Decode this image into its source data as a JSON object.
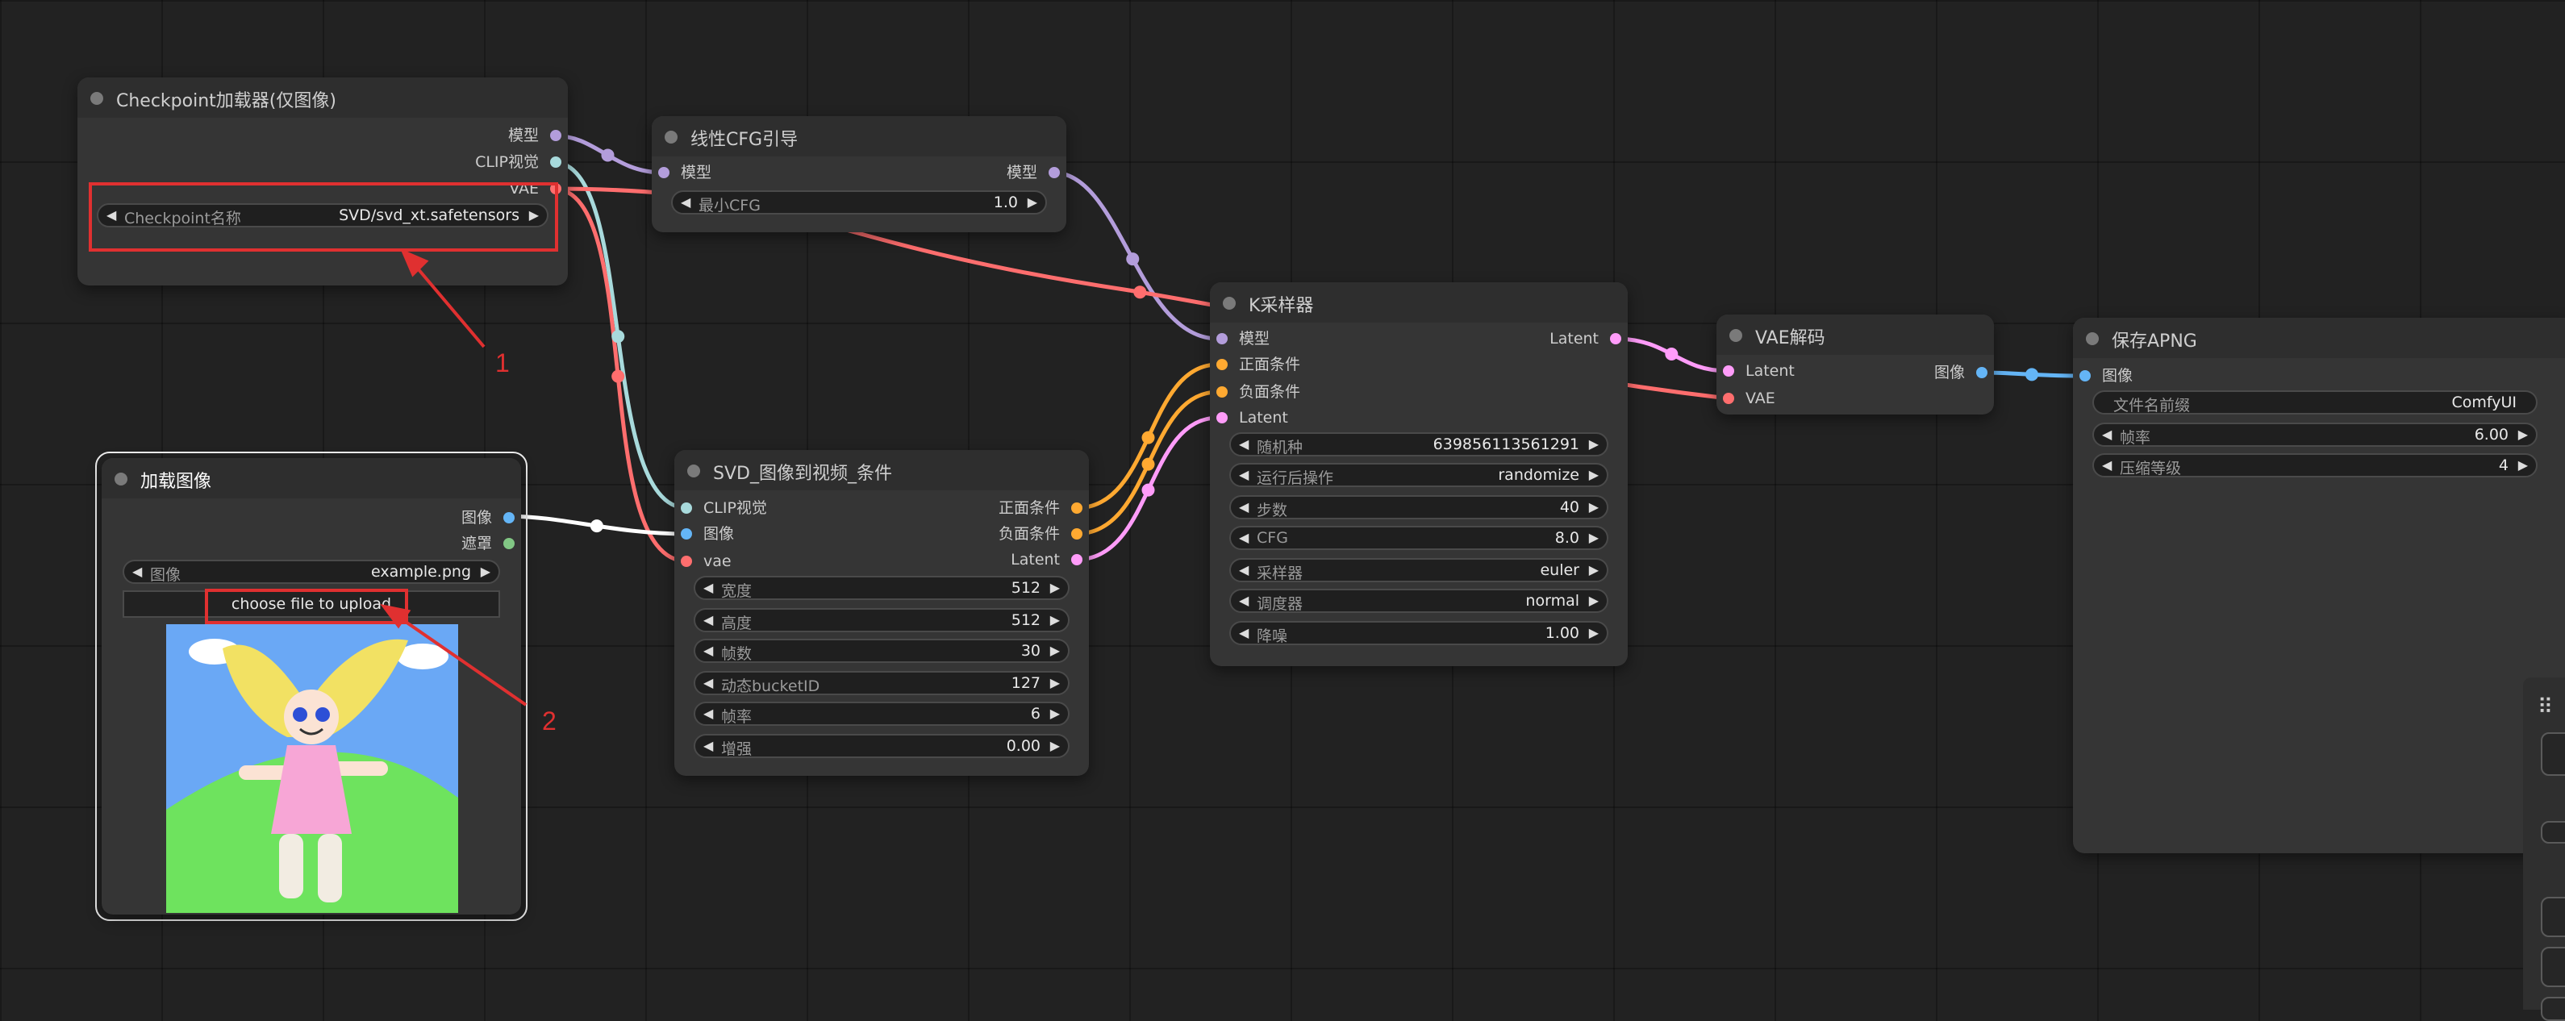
{
  "colors": {
    "model": "#b39ddb",
    "clip_vision": "#a8dadc",
    "vae": "#ff6e6e",
    "image": "#64b5f6",
    "mask": "#81c784",
    "conditioning": "#ffa931",
    "latent": "#ff9cf9",
    "annotation": "#e03030"
  },
  "nodes": {
    "checkpoint_loader": {
      "title": "Checkpoint加载器(仅图像)",
      "outputs": [
        "模型",
        "CLIP视觉",
        "VAE"
      ],
      "widget": {
        "label": "Checkpoint名称",
        "value": "SVD/svd_xt.safetensors"
      }
    },
    "linear_cfg": {
      "title": "线性CFG引导",
      "input": "模型",
      "output": "模型",
      "widget": {
        "label": "最小CFG",
        "value": "1.0"
      }
    },
    "load_image": {
      "title": "加载图像",
      "outputs": [
        "图像",
        "遮罩"
      ],
      "widget": {
        "label": "图像",
        "value": "example.png"
      },
      "upload_label": "choose file to upload"
    },
    "svd_conditioning": {
      "title": "SVD_图像到视频_条件",
      "inputs": [
        "CLIP视觉",
        "图像",
        "vae"
      ],
      "outputs": [
        "正面条件",
        "负面条件",
        "Latent"
      ],
      "widgets": [
        {
          "label": "宽度",
          "value": "512"
        },
        {
          "label": "高度",
          "value": "512"
        },
        {
          "label": "帧数",
          "value": "30"
        },
        {
          "label": "动态bucketID",
          "value": "127"
        },
        {
          "label": "帧率",
          "value": "6"
        },
        {
          "label": "增强",
          "value": "0.00"
        }
      ]
    },
    "ksampler": {
      "title": "K采样器",
      "inputs": [
        "模型",
        "正面条件",
        "负面条件",
        "Latent"
      ],
      "output": "Latent",
      "widgets": [
        {
          "label": "随机种",
          "value": "639856113561291"
        },
        {
          "label": "运行后操作",
          "value": "randomize"
        },
        {
          "label": "步数",
          "value": "40"
        },
        {
          "label": "CFG",
          "value": "8.0"
        },
        {
          "label": "采样器",
          "value": "euler"
        },
        {
          "label": "调度器",
          "value": "normal"
        },
        {
          "label": "降噪",
          "value": "1.00"
        }
      ]
    },
    "vae_decode": {
      "title": "VAE解码",
      "inputs": [
        "Latent",
        "VAE"
      ],
      "output": "图像"
    },
    "save_apng": {
      "title": "保存APNG",
      "input": "图像",
      "widgets": [
        {
          "label": "文件名前缀",
          "value": "ComfyUI"
        },
        {
          "label": "帧率",
          "value": "6.00"
        },
        {
          "label": "压缩等级",
          "value": "4"
        }
      ]
    }
  },
  "annotations": [
    "1",
    "2"
  ],
  "icons": {
    "drag_handle": "⠿",
    "arrow_left": "◀",
    "arrow_right": "▶"
  }
}
